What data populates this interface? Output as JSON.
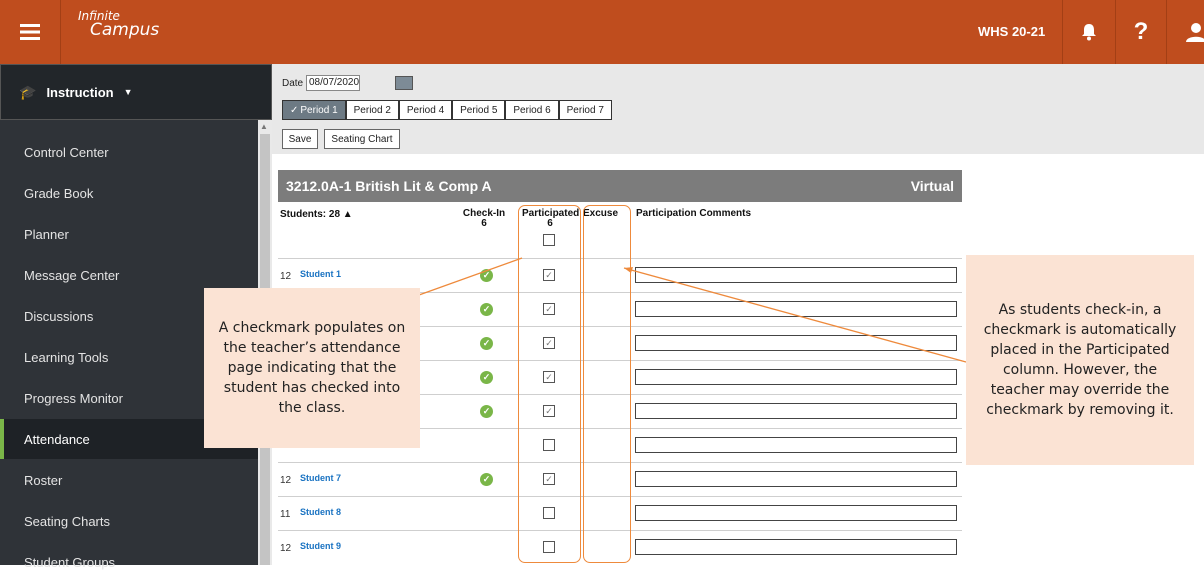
{
  "header": {
    "logo_line1": "Infinite",
    "logo_line2": "Campus",
    "year": "WHS 20-21",
    "help_glyph": "?"
  },
  "sidebar": {
    "heading": "Instruction",
    "items": [
      {
        "label": "Control Center",
        "name": "control-center"
      },
      {
        "label": "Grade Book",
        "name": "grade-book"
      },
      {
        "label": "Planner",
        "name": "planner"
      },
      {
        "label": "Message Center",
        "name": "message-center"
      },
      {
        "label": "Discussions",
        "name": "discussions"
      },
      {
        "label": "Learning Tools",
        "name": "learning-tools"
      },
      {
        "label": "Progress Monitor",
        "name": "progress-monitor"
      },
      {
        "label": "Attendance",
        "name": "attendance",
        "active": true
      },
      {
        "label": "Roster",
        "name": "roster"
      },
      {
        "label": "Seating Charts",
        "name": "seating-charts"
      },
      {
        "label": "Student Groups",
        "name": "student-groups"
      }
    ]
  },
  "toolbar": {
    "date_label": "Date",
    "date_value": "08/07/2020",
    "periods": [
      "Period 1",
      "Period 2",
      "Period 4",
      "Period 5",
      "Period 6",
      "Period 7"
    ],
    "selected_period_mark": "✓",
    "save_label": "Save",
    "seating_chart_label": "Seating Chart"
  },
  "section": {
    "course": "3212.0A-1 British Lit & Comp A",
    "mode": "Virtual"
  },
  "table": {
    "students_header": "Students: 28 ▲",
    "checkin_header": "Check-In",
    "checkin_count": "6",
    "participated_header": "Participated",
    "participated_count": "6",
    "excuse_header": "Excuse",
    "comments_header": "Participation Comments",
    "rows": [
      {
        "grade": "12",
        "name": "Student 1",
        "checked_in": true,
        "participated": true
      },
      {
        "grade": "",
        "name": "",
        "checked_in": true,
        "participated": true
      },
      {
        "grade": "",
        "name": "",
        "checked_in": true,
        "participated": true
      },
      {
        "grade": "",
        "name": "",
        "checked_in": true,
        "participated": true
      },
      {
        "grade": "",
        "name": "",
        "checked_in": true,
        "participated": true
      },
      {
        "grade": "",
        "name": "",
        "checked_in": false,
        "participated": false
      },
      {
        "grade": "12",
        "name": "Student 7",
        "checked_in": true,
        "participated": true
      },
      {
        "grade": "11",
        "name": "Student 8",
        "checked_in": false,
        "participated": false
      },
      {
        "grade": "12",
        "name": "Student 9",
        "checked_in": false,
        "participated": false
      }
    ]
  },
  "callouts": {
    "left": "A checkmark populates on the teacher’s attendance page indicating that the student has checked into the class.",
    "right": "As students check-in, a checkmark is automatically placed in the Participated column.  However, the teacher may override the checkmark by removing it."
  },
  "colors": {
    "topbar": "#bf4d1e",
    "sidebar": "#2f3338",
    "accent_green": "#7ab648",
    "callout_bg": "#fbe3d4",
    "highlight_orange": "#ee8a3c"
  }
}
